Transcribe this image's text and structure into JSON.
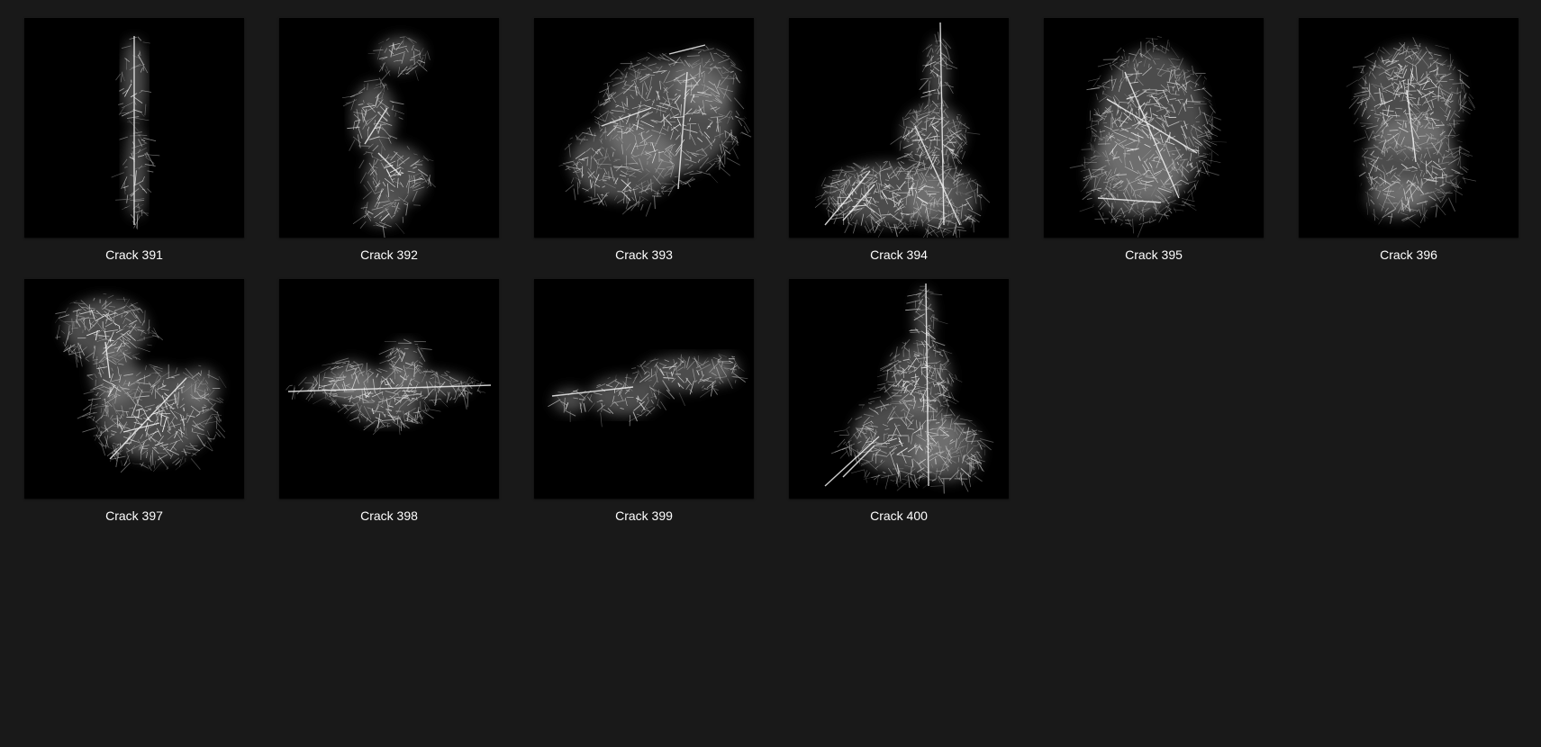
{
  "files": [
    {
      "name": "Crack 391",
      "shape": "vertical-streak"
    },
    {
      "name": "Crack 392",
      "shape": "wispy-vertical-blob"
    },
    {
      "name": "Crack 393",
      "shape": "large-cloud"
    },
    {
      "name": "Crack 394",
      "shape": "spire-fan"
    },
    {
      "name": "Crack 395",
      "shape": "oval-lattice"
    },
    {
      "name": "Crack 396",
      "shape": "rounded-cloud"
    },
    {
      "name": "Crack 397",
      "shape": "bulbous-cloud"
    },
    {
      "name": "Crack 398",
      "shape": "horizontal-band"
    },
    {
      "name": "Crack 399",
      "shape": "sparse-band"
    },
    {
      "name": "Crack 400",
      "shape": "spire-cloud"
    }
  ]
}
